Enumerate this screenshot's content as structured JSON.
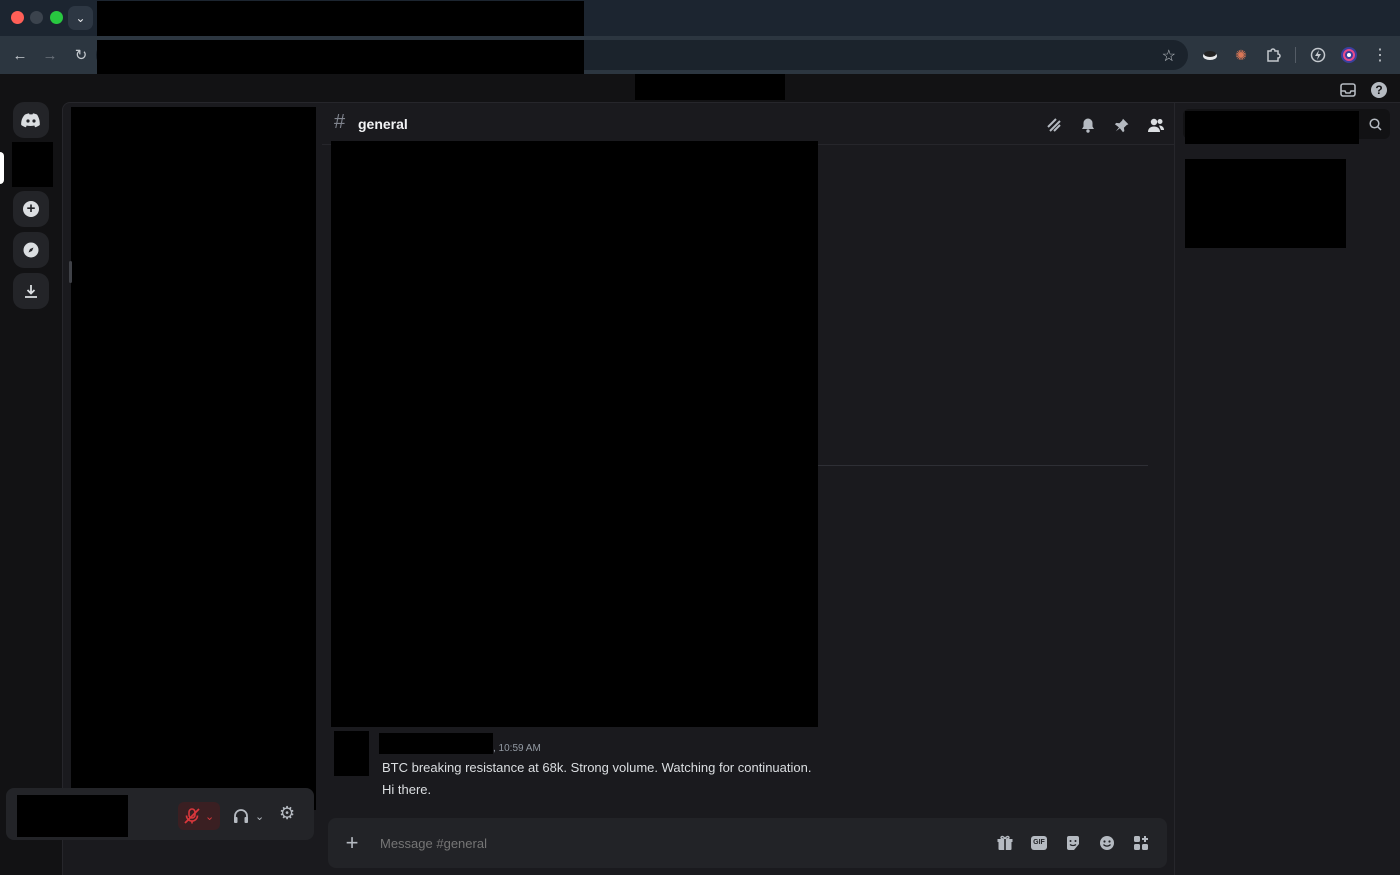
{
  "channel": {
    "name": "general",
    "hash": "#"
  },
  "message": {
    "timestamp": ", 10:59 AM",
    "lines": [
      "BTC breaking resistance at 68k. Strong volume. Watching for continuation.",
      "Hi there."
    ]
  },
  "composer": {
    "placeholder": "Message #general",
    "add_glyph": "+"
  },
  "icons": {
    "tabs_dropdown": "⌄",
    "back": "←",
    "forward": "→",
    "reload": "↻",
    "star": "☆",
    "menu": "⋮",
    "inbox": "▭",
    "help": "?",
    "threads": "⫽",
    "bell": "🔔",
    "pin": "📌",
    "members": "👥",
    "search": "⌕",
    "add_server": "+",
    "discover": "◉",
    "download": "⤓",
    "gift": "🎁",
    "gif": "GIF",
    "sticker": "▣",
    "emoji": "☻",
    "apps": "✣",
    "mute": "🎙",
    "headset": "🎧",
    "settings": "⚙",
    "caret": "⌄"
  },
  "colors": {
    "accent": "#5865f2",
    "danger": "#da373c",
    "mute_bg": "#3a1f22"
  }
}
